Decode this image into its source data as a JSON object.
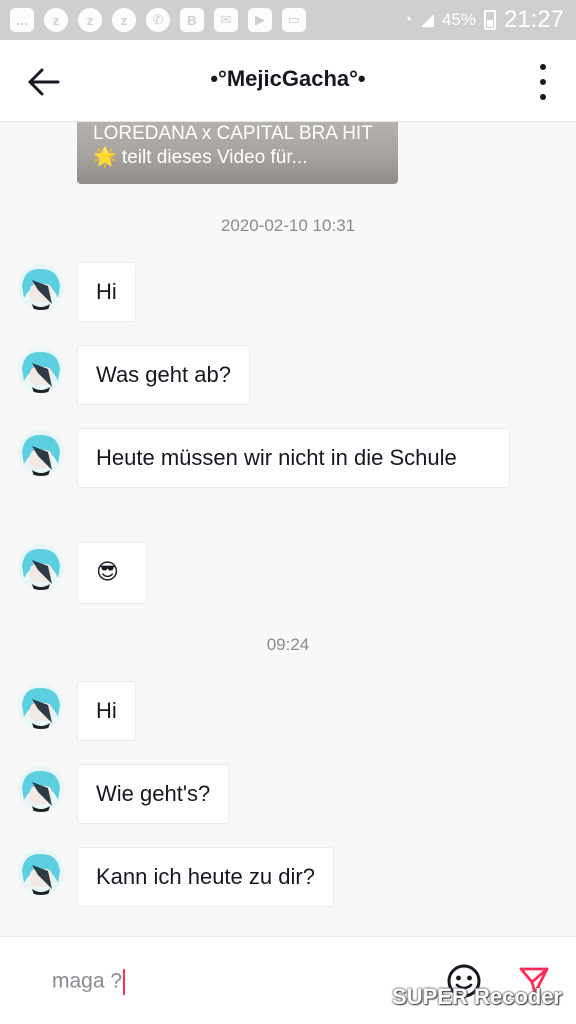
{
  "status_bar": {
    "battery": "45%",
    "time": "21:27"
  },
  "header": {
    "title": "•°MejicGacha°•"
  },
  "shared_video": {
    "text": "LOREDANA x CAPITAL BRA HIT🌟 teilt dieses Video für..."
  },
  "timestamps": [
    "2020-02-10 10:31",
    "09:24"
  ],
  "messages": [
    {
      "text": "Hi"
    },
    {
      "text": "Was geht ab?"
    },
    {
      "text": "Heute müssen wir nicht in die Schule"
    },
    {
      "text": "😎"
    },
    {
      "text": "Hi"
    },
    {
      "text": "Wie geht's?"
    },
    {
      "text": "Kann ich heute zu dir?"
    }
  ],
  "input": {
    "value": "maga ?"
  },
  "watermark": "SUPER Recoder",
  "colors": {
    "accent": "#fe2c55",
    "text": "#161823",
    "muted": "#8a8b91",
    "background": "#f8f8f8"
  }
}
